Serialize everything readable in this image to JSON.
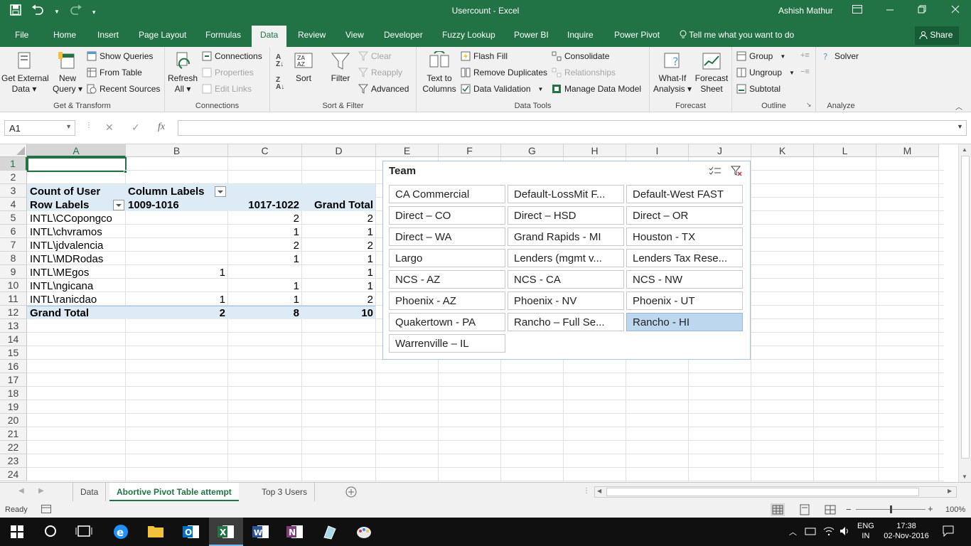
{
  "titlebar": {
    "title": "Usercount - Excel",
    "user": "Ashish Mathur",
    "qat": [
      "save-icon",
      "undo-icon",
      "redo-icon",
      "customize-icon"
    ]
  },
  "tabs": [
    "File",
    "Home",
    "Insert",
    "Page Layout",
    "Formulas",
    "Data",
    "Review",
    "View",
    "Developer",
    "Fuzzy Lookup",
    "Power BI",
    "Inquire",
    "Power Pivot"
  ],
  "active_tab": "Data",
  "tell_me": "Tell me what you want to do",
  "share": "Share",
  "ribbon": {
    "get_transform": {
      "label": "Get & Transform",
      "get_external_1": "Get External",
      "get_external_2": "Data",
      "new_query_1": "New",
      "new_query_2": "Query",
      "show_queries": "Show Queries",
      "from_table": "From Table",
      "recent_sources": "Recent Sources"
    },
    "connections": {
      "label": "Connections",
      "refresh_1": "Refresh",
      "refresh_2": "All",
      "connections": "Connections",
      "properties": "Properties",
      "edit_links": "Edit Links"
    },
    "sort_filter": {
      "label": "Sort & Filter",
      "sort": "Sort",
      "filter": "Filter",
      "clear": "Clear",
      "reapply": "Reapply",
      "advanced": "Advanced"
    },
    "data_tools": {
      "label": "Data Tools",
      "text_to_1": "Text to",
      "text_to_2": "Columns",
      "flash_fill": "Flash Fill",
      "remove_duplicates": "Remove Duplicates",
      "data_validation": "Data Validation",
      "consolidate": "Consolidate",
      "relationships": "Relationships",
      "manage_model": "Manage Data Model"
    },
    "forecast": {
      "label": "Forecast",
      "what_if_1": "What-If",
      "what_if_2": "Analysis",
      "forecast_1": "Forecast",
      "forecast_2": "Sheet"
    },
    "outline": {
      "label": "Outline",
      "group": "Group",
      "ungroup": "Ungroup",
      "subtotal": "Subtotal"
    },
    "analyze": {
      "label": "Analyze",
      "solver": "Solver"
    }
  },
  "formula_bar": {
    "name_box": "A1",
    "formula": ""
  },
  "columns": [
    "A",
    "B",
    "C",
    "D",
    "E",
    "F",
    "G",
    "H",
    "I",
    "J",
    "K",
    "L",
    "M"
  ],
  "rows": [
    "1",
    "2",
    "3",
    "4",
    "5",
    "6",
    "7",
    "8",
    "9",
    "10",
    "11",
    "12",
    "13",
    "14",
    "15",
    "16",
    "17",
    "18",
    "19",
    "20",
    "21",
    "22",
    "23",
    "24"
  ],
  "pivot": {
    "r3": {
      "a": "Count of User",
      "b": "Column Labels"
    },
    "r4": {
      "a": "Row Labels",
      "b": "1009-1016",
      "c": "1017-1022",
      "d": "Grand Total"
    },
    "data": [
      {
        "user": "INTL\\CCopongco",
        "b": "",
        "c": "2",
        "d": "2"
      },
      {
        "user": "INTL\\chvramos",
        "b": "",
        "c": "1",
        "d": "1"
      },
      {
        "user": "INTL\\jdvalencia",
        "b": "",
        "c": "2",
        "d": "2"
      },
      {
        "user": "INTL\\MDRodas",
        "b": "",
        "c": "1",
        "d": "1"
      },
      {
        "user": "INTL\\MEgos",
        "b": "1",
        "c": "",
        "d": "1"
      },
      {
        "user": "INTL\\ngicana",
        "b": "",
        "c": "1",
        "d": "1"
      },
      {
        "user": "INTL\\ranicdao",
        "b": "1",
        "c": "1",
        "d": "2"
      }
    ],
    "total": {
      "a": "Grand Total",
      "b": "2",
      "c": "8",
      "d": "10"
    }
  },
  "slicer": {
    "title": "Team",
    "items": [
      "CA Commercial",
      "Default-LossMit F...",
      "Default-West FAST",
      "Direct – CO",
      "Direct – HSD",
      "Direct – OR",
      "Direct – WA",
      "Grand Rapids - MI",
      "Houston - TX",
      "Largo",
      "Lenders (mgmt v...",
      "Lenders Tax Rese...",
      "NCS - AZ",
      "NCS - CA",
      "NCS - NW",
      "Phoenix - AZ",
      "Phoenix - NV",
      "Phoenix - UT",
      "Quakertown - PA",
      "Rancho – Full Se...",
      "Rancho - HI",
      "Warrenville – IL"
    ],
    "selected": "Rancho - HI"
  },
  "sheets": [
    "Data",
    "Abortive Pivot Table attempt",
    "Top 3 Users"
  ],
  "active_sheet": "Abortive Pivot Table attempt",
  "status": {
    "ready": "Ready",
    "zoom": "100%",
    "zoom_fraction": 0.5
  },
  "taskbar": {
    "lang_1": "ENG",
    "lang_2": "IN",
    "time": "17:38",
    "date": "02-Nov-2016",
    "colors": {
      "excel": "#217346",
      "word": "#2b579a",
      "onenote": "#80397b",
      "outlook": "#0072c6",
      "edge": "#1e90ff",
      "explorer": "#f3c13a"
    }
  },
  "colors": {
    "accent": "#217346",
    "pivot_header": "#ddebf7",
    "slicer_selected": "#bdd7ee"
  }
}
